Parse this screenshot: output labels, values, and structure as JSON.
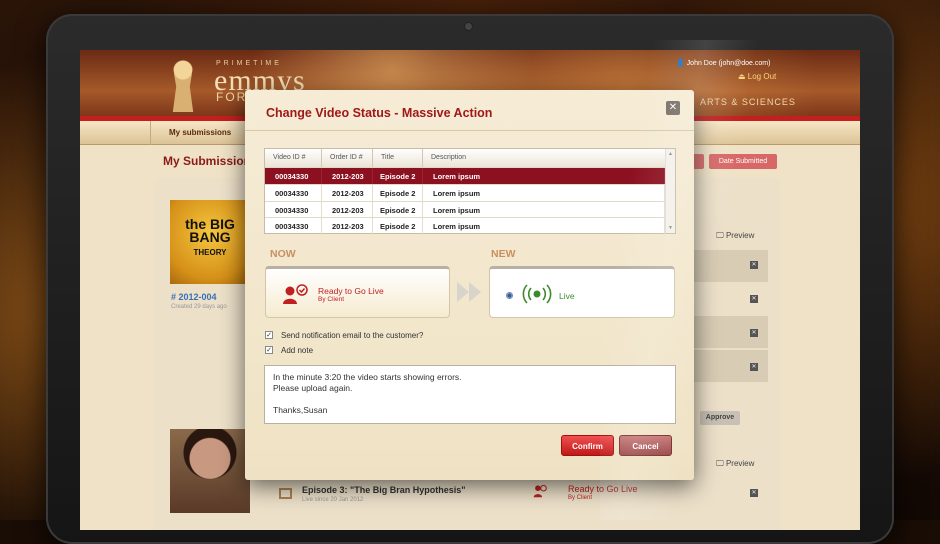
{
  "header": {
    "logo_small": "PRIMETIME",
    "logo_big": "emmys",
    "logo_for": "FOR",
    "arts": "ARTS & SCIENCES",
    "user": "John Doe (john@doe.com)",
    "logout": "Log Out"
  },
  "nav": {
    "item": "My submissions"
  },
  "page": {
    "title": "My Submissions",
    "date_button": "Date Submitted",
    "card1": {
      "poster_line1": "the BIG",
      "poster_line2": "BANG",
      "poster_line3": "THEORY",
      "id": "# 2012-004",
      "created": "Created 29 days ago"
    },
    "preview_label": "Preview",
    "approve_label": "Approve",
    "card2": {
      "episode": "Episode 3: \"The Big Bran Hypothesis\"",
      "episode_sub": "Live since 20 Jan 2012",
      "status": "Ready to Go Live",
      "status_sub": "By Client"
    }
  },
  "modal": {
    "title": "Change Video Status - Massive Action",
    "close": "✕",
    "columns": [
      "Video ID #",
      "Order ID #",
      "Title",
      "Description"
    ],
    "rows": [
      {
        "video": "00034330",
        "order": "2012-203",
        "title": "Episode 2",
        "desc": "Lorem ipsum"
      },
      {
        "video": "00034330",
        "order": "2012-203",
        "title": "Episode 2",
        "desc": "Lorem ipsum"
      },
      {
        "video": "00034330",
        "order": "2012-203",
        "title": "Episode 2",
        "desc": "Lorem ipsum"
      },
      {
        "video": "00034330",
        "order": "2012-203",
        "title": "Episode 2",
        "desc": "Lorem ipsum"
      }
    ],
    "now_label": "NOW",
    "new_label": "NEW",
    "now_status": "Ready to Go Live",
    "now_status_sub": "By Client",
    "new_status": "Live",
    "check_email": "Send notification email to the customer?",
    "check_note": "Add note",
    "note_text": "In the minute 3:20 the video starts showing errors.\nPlease upload again.\n\nThanks,Susan",
    "confirm": "Confirm",
    "cancel": "Cancel"
  },
  "colors": {
    "accent": "#a01818",
    "selected_row": "#8b1020",
    "live": "#3c8a28"
  }
}
